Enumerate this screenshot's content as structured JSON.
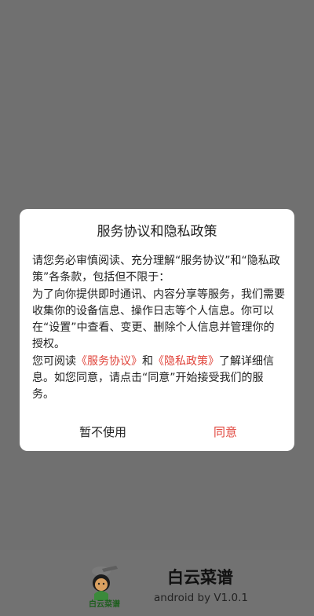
{
  "dialog": {
    "title": "服务协议和隐私政策",
    "para1": "请您务必审慎阅读、充分理解“服务协议”和“隐私政策”各条款，包括但不限于：",
    "para2": "为了向你提供即时通讯、内容分享等服务，我们需要收集你的设备信息、操作日志等个人信息。你可以在“设置”中查看、变更、删除个人信息并管理你的授权。",
    "para3_prefix": "您可阅读",
    "link_service": "《服务协议》",
    "para3_and": "和",
    "link_privacy": "《隐私政策》",
    "para3_suffix": "了解详细信息。如您同意，请点击“同意”开始接受我们的服务。",
    "decline_label": "暂不使用",
    "agree_label": "同意"
  },
  "splash": {
    "logo_caption": "白云菜谱",
    "app_name": "白云菜谱",
    "version_text": "android by V1.0.1"
  },
  "colors": {
    "overlay": "#707070",
    "dialog_bg": "#ffffff",
    "accent_red": "#e0433a",
    "text": "#222222"
  },
  "icons": {
    "logo": "chef-logo-icon"
  }
}
